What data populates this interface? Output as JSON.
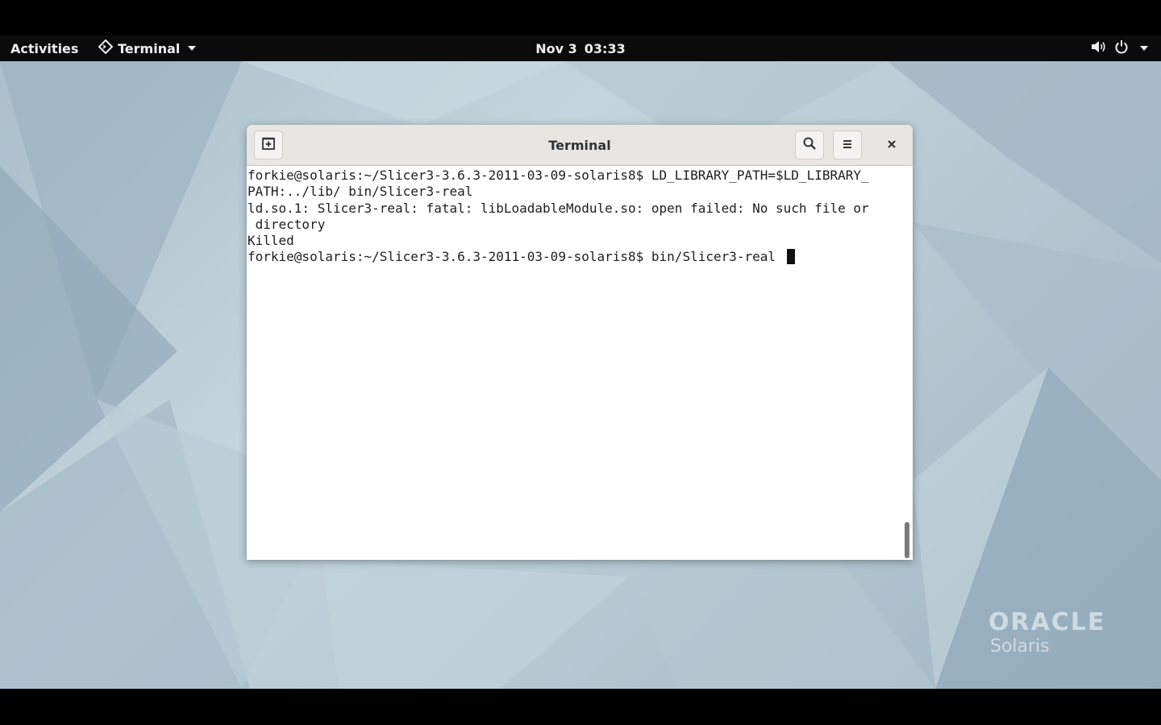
{
  "topbar": {
    "activities": "Activities",
    "app_menu": {
      "label": "Terminal",
      "icon": "terminal-app-icon"
    },
    "clock": {
      "date": "Nov 3",
      "time": "03:33"
    },
    "system_icons": [
      "volume-icon",
      "power-icon",
      "chevron-down-icon"
    ]
  },
  "window": {
    "title": "Terminal",
    "buttons": [
      "new-tab-icon",
      "search-icon",
      "hamburger-menu-icon",
      "close-icon"
    ]
  },
  "terminal": {
    "lines": [
      "forkie@solaris:~/Slicer3-3.6.3-2011-03-09-solaris8$ LD_LIBRARY_PATH=$LD_LIBRARY_",
      "PATH:../lib/ bin/Slicer3-real",
      "ld.so.1: Slicer3-real: fatal: libLoadableModule.so: open failed: No such file or",
      " directory",
      "Killed"
    ],
    "prompt_line": "forkie@solaris:~/Slicer3-3.6.3-2011-03-09-solaris8$ bin/Slicer3-real "
  },
  "branding": {
    "line1": "ORACLE",
    "line2": "Solaris"
  }
}
